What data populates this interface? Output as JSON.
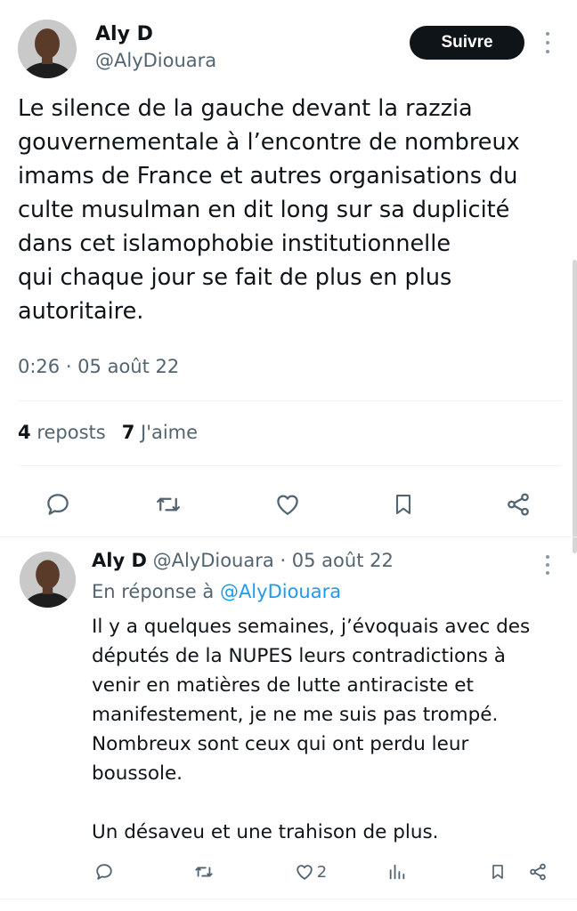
{
  "main_tweet": {
    "author_name": "Aly D",
    "author_handle": "@AlyDiouara",
    "follow_label": "Suivre",
    "text_lines": [
      "Le silence de la gauche devant la razzia",
      "gouvernementale à l’encontre de nombreux",
      "imams de France et autres organisations du",
      "culte musulman en dit long sur sa duplicité",
      "dans cet islamophobie institutionnelle",
      "qui chaque jour se fait de plus en plus",
      "autoritaire."
    ],
    "timestamp": "0:26 · 05 août 22",
    "reposts_count": "4",
    "reposts_label": "reposts",
    "likes_count": "7",
    "likes_label": "J'aime"
  },
  "reply_tweet": {
    "author_name": "Aly D",
    "author_handle": "@AlyDiouara",
    "date": "· 05 août 22",
    "reply_prefix": "En réponse à",
    "reply_to_handle": "@AlyDiouara",
    "text_lines": [
      "Il y a quelques semaines, j’évoquais avec des",
      "députés de la NUPES leurs contradictions à",
      "venir en matières de lutte antiraciste et",
      "manifestement, je ne me suis pas trompé.",
      "Nombreux sont ceux qui ont perdu leur",
      "boussole.",
      "",
      "Un désaveu et une trahison de plus."
    ],
    "like_count": "2"
  },
  "icons": {
    "reply": "speech-bubble-icon",
    "repost": "repost-arrows-icon",
    "like": "heart-icon",
    "bookmark": "bookmark-icon",
    "share": "share-nodes-icon",
    "views": "bar-chart-icon",
    "more": "vertical-dots-icon"
  },
  "colors": {
    "text": "#0f1419",
    "secondary": "#536471",
    "link": "#1d9bf0",
    "follow_bg": "#0f1419",
    "divider": "#eff3f4"
  }
}
